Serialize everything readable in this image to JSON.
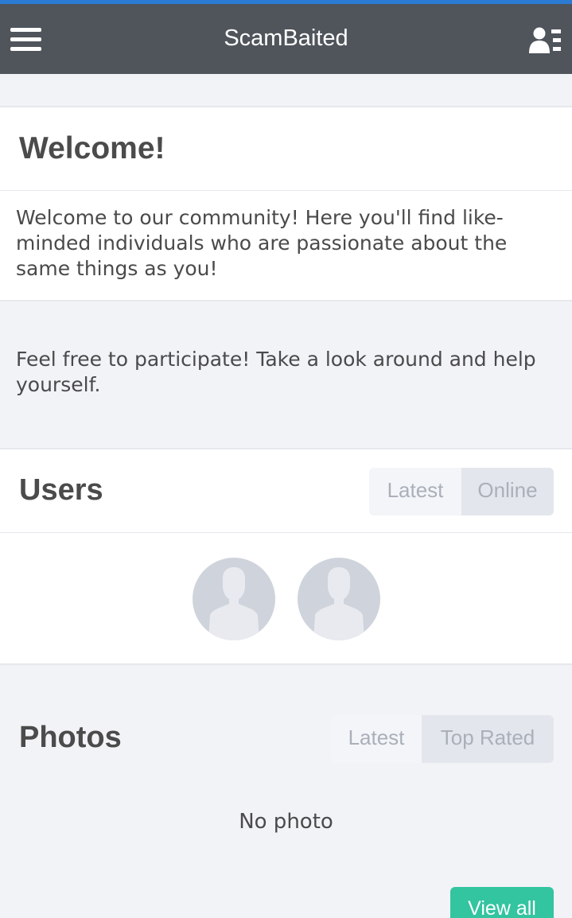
{
  "header": {
    "title": "ScamBaited",
    "menu_icon": "hamburger-menu-icon",
    "user_icon": "user-list-icon",
    "accent_color": "#2a7bd3",
    "background_color": "#50555c"
  },
  "welcome": {
    "title": "Welcome!",
    "text": "Welcome to our community! Here you'll find like-minded individuals who are passionate about the same things as you!",
    "participate": "Feel free to participate! Take a look around and help yourself."
  },
  "users": {
    "title": "Users",
    "tabs": [
      "Latest",
      "Online"
    ],
    "active_tab": "Online",
    "avatars": [
      {
        "icon": "default-avatar-icon"
      },
      {
        "icon": "default-avatar-icon"
      }
    ]
  },
  "photos": {
    "title": "Photos",
    "tabs": [
      "Latest",
      "Top Rated"
    ],
    "active_tab": "Top Rated",
    "empty_text": "No photo",
    "view_all_label": "View all",
    "button_color": "#33c4a0"
  }
}
